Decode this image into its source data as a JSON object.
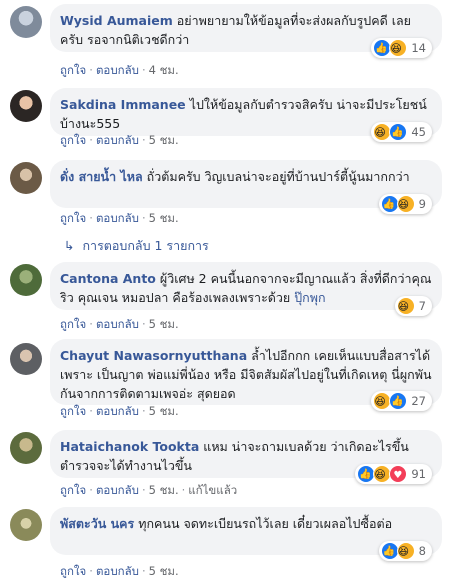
{
  "comments": [
    {
      "author": "Wysid Aumaiem",
      "text": "อย่าพยายามให้ข้อมูลที่จะส่งผลกับรูปคดี เลยครับ รอจากนิติเวชดีกว่า",
      "reaction_types": [
        "like",
        "haha"
      ],
      "reaction_count": "14",
      "like_label": "ถูกใจ",
      "reply_label": "ตอบกลับ",
      "time": "4 ชม."
    },
    {
      "author": "Sakdina Immanee",
      "text": "ไปให้ข้อมูลกับตำรวจสิครับ น่าจะมีประโยชน์บ้างนะ555",
      "reaction_types": [
        "haha",
        "like"
      ],
      "reaction_count": "45",
      "like_label": "ถูกใจ",
      "reply_label": "ตอบกลับ",
      "time": "5 ชม."
    },
    {
      "author": "ดั่ง สายน้ำ ไหล",
      "text": "ถั่วต้มครับ วิญเบลน่าจะอยู่ที่บ้านปาร์ตี้นู้นมากกว่า",
      "reaction_types": [
        "like",
        "haha"
      ],
      "reaction_count": "9",
      "like_label": "ถูกใจ",
      "reply_label": "ตอบกลับ",
      "time": "5 ชม.",
      "replies_label": "การตอบกลับ 1 รายการ"
    },
    {
      "author": "Cantona Anto",
      "text": "ผู้วิเศษ 2 คนนี้นอกจากจะมีญาณแล้ว สิ่งที่ดีกว่าคุณริว คุณเจน หมอปลา คือร้องเพลงเพราะด้วย",
      "mention": "ปุ๊กพุก",
      "reaction_types": [
        "haha"
      ],
      "reaction_count": "7",
      "like_label": "ถูกใจ",
      "reply_label": "ตอบกลับ",
      "time": "5 ชม."
    },
    {
      "author": "Chayut Nawasornyutthana",
      "text": "ล้ำไปอีกกก เคยเห็นแบบสื่อสารได้เพราะ เป็นญาต พ่อแม่พี่น้อง หรือ มีจิตสัมผัสไปอยู่ในที่เกิดเหตุ นี่ผูกพันกันจากการติดตามเพจอ่ะ สุดยอด",
      "reaction_types": [
        "haha",
        "like"
      ],
      "reaction_count": "27",
      "like_label": "ถูกใจ",
      "reply_label": "ตอบกลับ",
      "time": "5 ชม."
    },
    {
      "author": "Hataichanok Tookta",
      "text": "แหม น่าจะถามเบลด้วย ว่าเกิดอะไรขึ้น ตำรวจจะได้ทำงานไวขึ้น",
      "reaction_types": [
        "like",
        "haha",
        "love"
      ],
      "reaction_count": "91",
      "like_label": "ถูกใจ",
      "reply_label": "ตอบกลับ",
      "time": "5 ชม.",
      "edited": "แก้ไขแล้ว"
    },
    {
      "author": "พัสตะวัน นคร",
      "text": "ทุกคนน จดทะเบียนรถไว้เลย เดี๋ยวเผลอไปซื้อต่อ",
      "reaction_types": [
        "like",
        "haha"
      ],
      "reaction_count": "8",
      "like_label": "ถูกใจ",
      "reply_label": "ตอบกลับ",
      "time": "5 ชม."
    }
  ],
  "colors": {
    "link": "#385898",
    "bubble": "#f2f3f5",
    "meta": "#65676b",
    "like": "#1877f2",
    "haha": "#f7b125",
    "love": "#f33e58"
  }
}
